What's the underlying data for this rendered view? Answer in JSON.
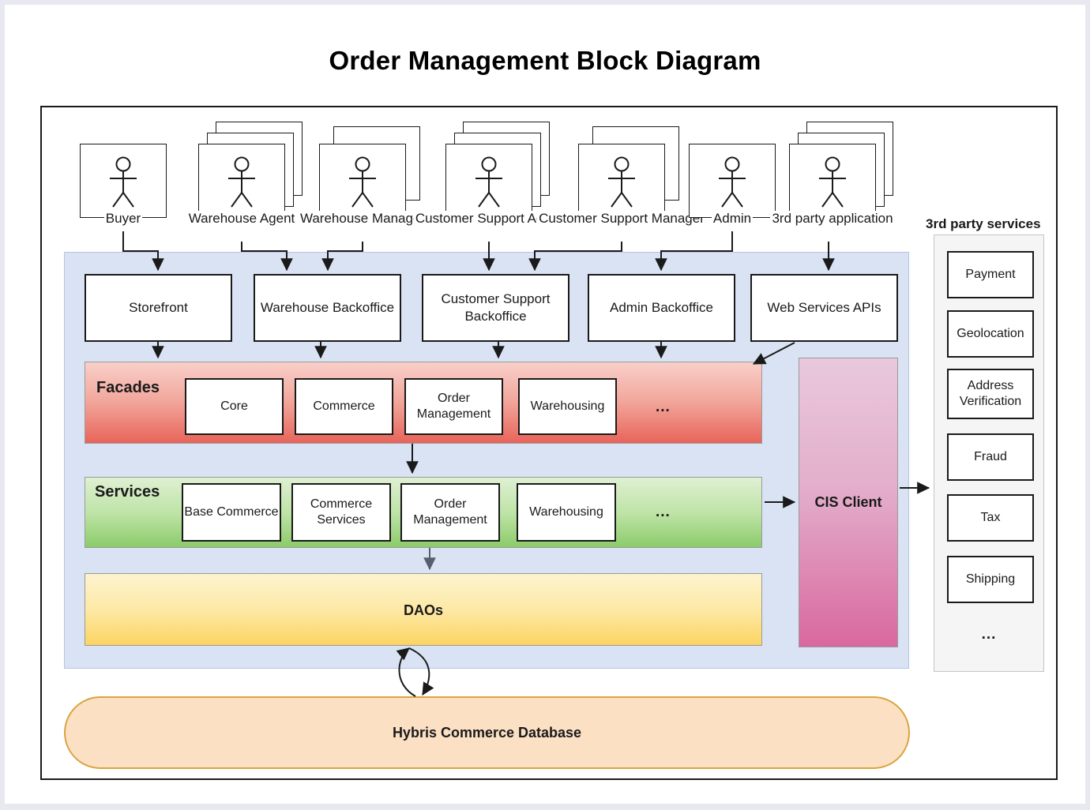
{
  "title": "Order Management Block Diagram",
  "actors": [
    {
      "name": "Buyer",
      "stacked": false
    },
    {
      "name": "Warehouse Agent",
      "stacked": true
    },
    {
      "name": "Warehouse Manager",
      "stacked": true
    },
    {
      "name": "Customer Support Agent",
      "stacked": true
    },
    {
      "name": "Customer Support Manager",
      "stacked": true
    },
    {
      "name": "Admin",
      "stacked": false
    },
    {
      "name": "3rd party application",
      "stacked": true
    }
  ],
  "applications": [
    {
      "label": "Storefront"
    },
    {
      "label": "Warehouse Backoffice"
    },
    {
      "label": "Customer Support Backoffice"
    },
    {
      "label": "Admin Backoffice"
    },
    {
      "label": "Web Services APIs"
    }
  ],
  "layers": [
    {
      "id": "facades",
      "title": "Facades",
      "color": "#e8645a",
      "modules": [
        "Core",
        "Commerce",
        "Order Management",
        "Warehousing"
      ],
      "more": "..."
    },
    {
      "id": "services",
      "title": "Services",
      "color": "#8ccb6a",
      "modules": [
        "Base Commerce",
        "Commerce Services",
        "Order Management",
        "Warehousing"
      ],
      "more": "..."
    },
    {
      "id": "daos",
      "title": "DAOs",
      "color": "#fcd462",
      "modules": [],
      "more": ""
    }
  ],
  "cis_client": {
    "label": "CIS Client",
    "color": "#d9689f"
  },
  "third_party": {
    "title": "3rd party services",
    "items": [
      "Payment",
      "Geolocation",
      "Address Verification",
      "Fraud",
      "Tax",
      "Shipping"
    ],
    "more": "..."
  },
  "database": {
    "label": "Hybris Commerce Database",
    "color": "#fbe0c4"
  }
}
